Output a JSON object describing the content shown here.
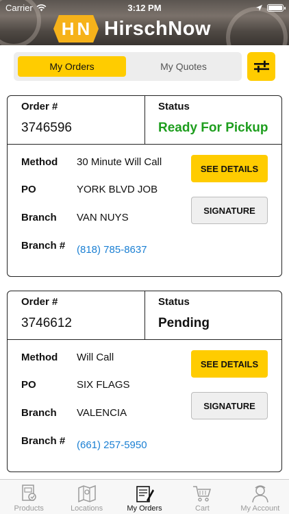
{
  "status_bar": {
    "carrier": "Carrier",
    "time": "3:12 PM"
  },
  "brand": {
    "mark": [
      "H",
      "N"
    ],
    "name": "HirschNow",
    "accent": "#ffcc00"
  },
  "segment": {
    "my_orders": "My Orders",
    "my_quotes": "My Quotes",
    "selected": "My Orders"
  },
  "labels": {
    "order_num": "Order #",
    "status": "Status",
    "method": "Method",
    "po": "PO",
    "branch": "Branch",
    "branch_num": "Branch #",
    "see_details": "SEE DETAILS",
    "signature": "SIGNATURE"
  },
  "orders": [
    {
      "order_number": "3746596",
      "status": "Ready For Pickup",
      "status_color": "#1e9e1e",
      "method": "30 Minute Will Call",
      "po": "YORK BLVD JOB",
      "branch": "VAN NUYS",
      "branch_phone": "(818) 785-8637"
    },
    {
      "order_number": "3746612",
      "status": "Pending",
      "status_color": "#111111",
      "method": "Will Call",
      "po": "SIX FLAGS",
      "branch": "VALENCIA",
      "branch_phone": "(661) 257-5950"
    }
  ],
  "tabs": [
    {
      "label": "Products",
      "icon": "products-icon"
    },
    {
      "label": "Locations",
      "icon": "map-icon"
    },
    {
      "label": "My Orders",
      "icon": "orders-icon",
      "active": true
    },
    {
      "label": "Cart",
      "icon": "cart-icon"
    },
    {
      "label": "My Account",
      "icon": "account-icon"
    }
  ]
}
